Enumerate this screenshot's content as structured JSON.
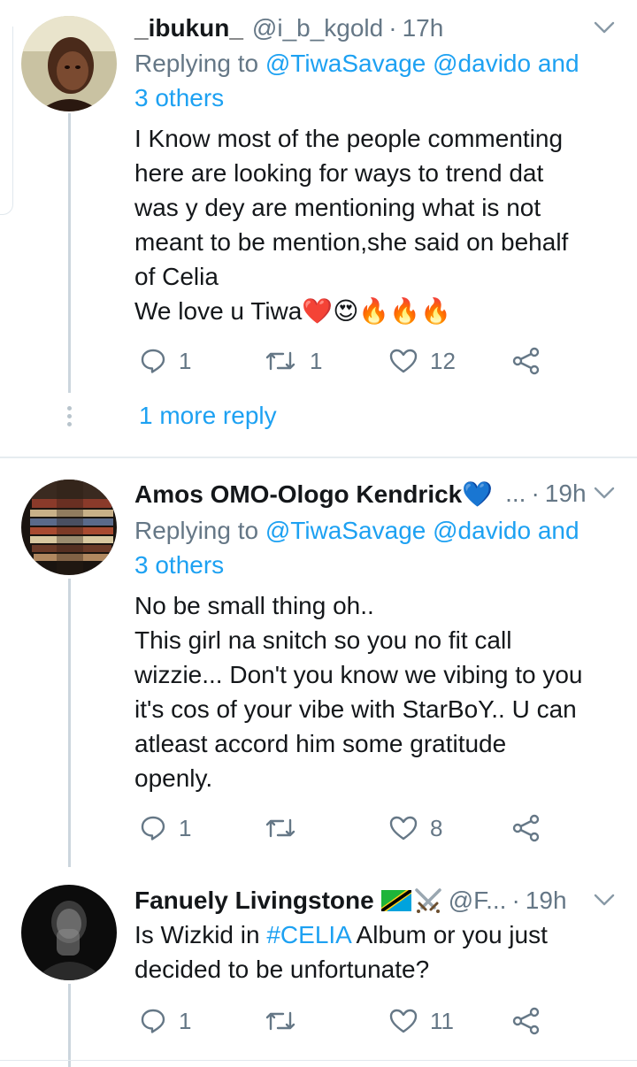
{
  "tweets": [
    {
      "name": "_ibukun_",
      "handle": "@i_b_kgold",
      "time": "17h",
      "replying": {
        "prefix": "Replying to",
        "mention1": "@TiwaSavage",
        "mention2": "@davido",
        "and": "and",
        "others": "3 others"
      },
      "lines": [
        "I Know most of the people commenting",
        "here are looking for ways to trend dat",
        "was y dey are mentioning what is not",
        "meant to be mention,she said on behalf",
        "of Celia",
        "We love u Tiwa❤️😍🔥🔥🔥"
      ],
      "replies": "1",
      "retweets": "1",
      "likes": "12",
      "more_reply": "1 more reply"
    },
    {
      "name": "Amos OMO-Ologo Kendrick💙",
      "handle": "...",
      "time": "19h",
      "replying": {
        "prefix": "Replying to",
        "mention1": "@TiwaSavage",
        "mention2": "@davido",
        "and": "and",
        "others": "3 others"
      },
      "lines": [
        "No be small thing oh..",
        "This girl na snitch so you no fit call",
        "wizzie... Don't you know we vibing to you",
        "it's cos of your vibe with StarBoY.. U can",
        "atleast accord him some gratitude",
        "openly."
      ],
      "replies": "1",
      "retweets": "",
      "likes": "8"
    },
    {
      "name": "Fanuely Livingstone",
      "handle": "@F...",
      "time": "19h",
      "text_prefix": "Is Wizkid in ",
      "hashtag": "#CELIA",
      "text_suffix": " Album or you just",
      "line2": "decided to be unfortunate?",
      "replies": "1",
      "retweets": "",
      "likes": "11"
    }
  ],
  "separator_dot": "·",
  "icons": {
    "reply": "reply-icon",
    "retweet": "retweet-icon",
    "like": "heart-icon",
    "share": "share-icon",
    "menu": "chevron-down-icon",
    "flag": "tanzania-flag-icon",
    "swords": "crossed-swords-icon"
  },
  "colors": {
    "accent": "#1da1f2",
    "muted": "#657786",
    "text": "#14171a",
    "divider": "#e6ecf0"
  }
}
